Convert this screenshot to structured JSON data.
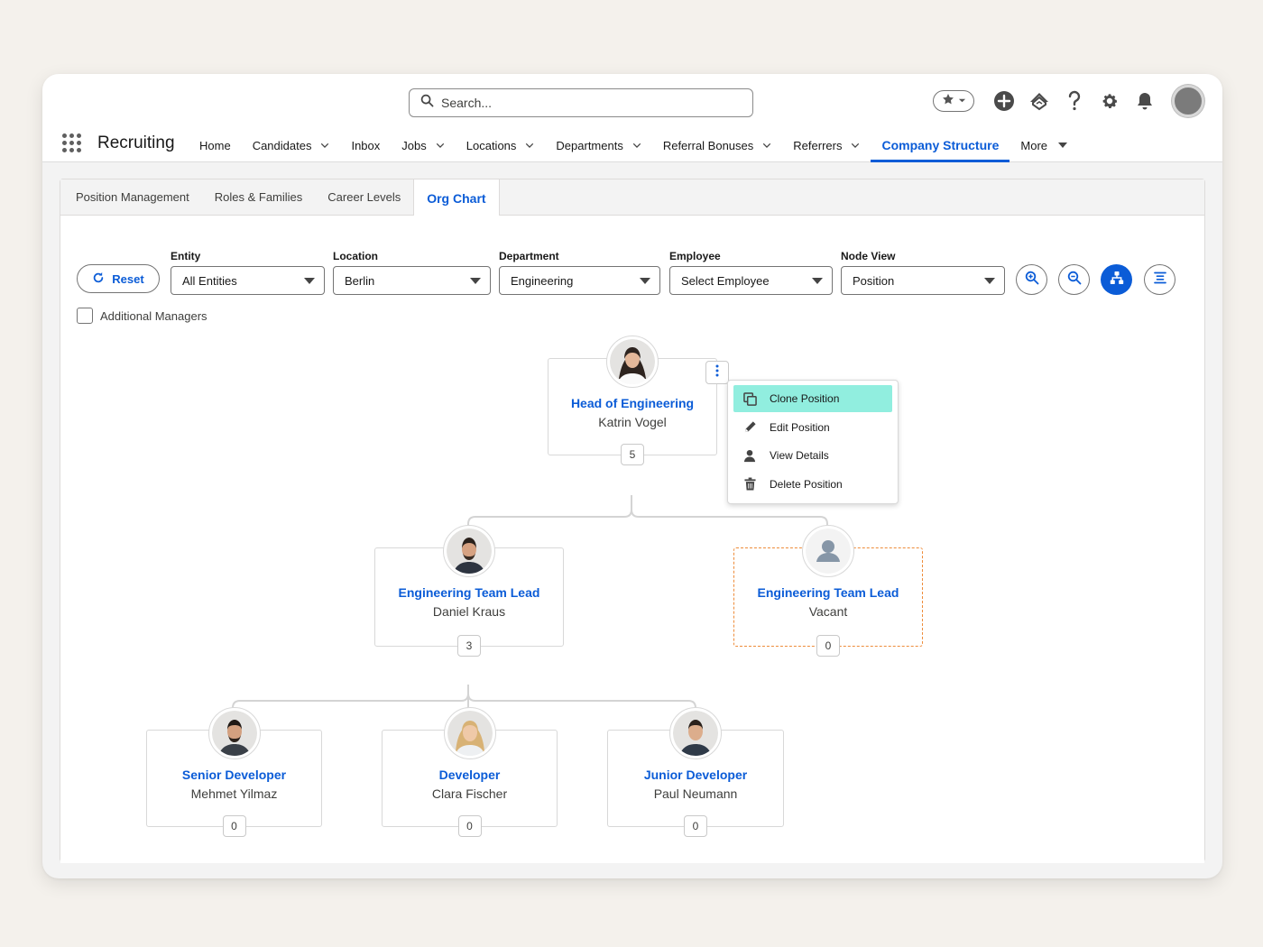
{
  "header": {
    "search_placeholder": "Search...",
    "app_name": "Recruiting",
    "nav": [
      {
        "label": "Home",
        "chevron": false
      },
      {
        "label": "Candidates",
        "chevron": true
      },
      {
        "label": "Inbox",
        "chevron": false
      },
      {
        "label": "Jobs",
        "chevron": true
      },
      {
        "label": "Locations",
        "chevron": true
      },
      {
        "label": "Departments",
        "chevron": true
      },
      {
        "label": "Referral Bonuses",
        "chevron": true
      },
      {
        "label": "Referrers",
        "chevron": true
      },
      {
        "label": "Company Structure",
        "active": true
      },
      {
        "label": "More",
        "triangle": true
      }
    ]
  },
  "tabs": [
    "Position Management",
    "Roles & Families",
    "Career Levels",
    "Org Chart"
  ],
  "active_tab": "Org Chart",
  "filters": {
    "reset_label": "Reset",
    "entity": {
      "label": "Entity",
      "value": "All Entities"
    },
    "location": {
      "label": "Location",
      "value": "Berlin"
    },
    "department": {
      "label": "Department",
      "value": "Engineering"
    },
    "employee": {
      "label": "Employee",
      "value": "Select Employee"
    },
    "node_view": {
      "label": "Node View",
      "value": "Position"
    },
    "additional_managers_label": "Additional Managers",
    "additional_managers_checked": false
  },
  "org_chart": {
    "root": {
      "title": "Head of Engineering",
      "name": "Katrin Vogel",
      "count": "5"
    },
    "level1": [
      {
        "title": "Engineering Team Lead",
        "name": "Daniel Kraus",
        "count": "3"
      },
      {
        "title": "Engineering Team Lead",
        "name": "Vacant",
        "count": "0",
        "vacant": true
      }
    ],
    "level2": [
      {
        "title": "Senior Developer",
        "name": "Mehmet Yilmaz",
        "count": "0"
      },
      {
        "title": "Developer",
        "name": "Clara Fischer",
        "count": "0"
      },
      {
        "title": "Junior Developer",
        "name": "Paul Neumann",
        "count": "0"
      }
    ]
  },
  "context_menu": {
    "items": [
      {
        "label": "Clone Position",
        "icon": "clone-icon",
        "highlighted": true
      },
      {
        "label": "Edit Position",
        "icon": "edit-icon"
      },
      {
        "label": "View Details",
        "icon": "person-icon"
      },
      {
        "label": "Delete Position",
        "icon": "trash-icon"
      }
    ]
  },
  "colors": {
    "brand_blue": "#0b5cd7",
    "vacant_border": "#ee8c3a",
    "menu_highlight": "#91eedf"
  }
}
